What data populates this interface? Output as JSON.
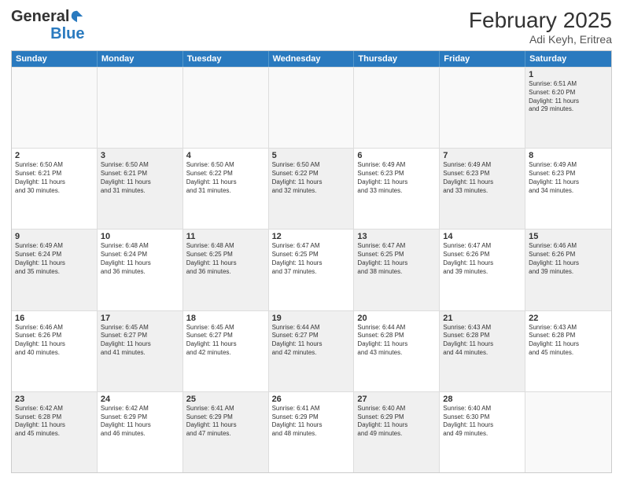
{
  "header": {
    "logo_general": "General",
    "logo_blue": "Blue",
    "title": "February 2025",
    "location": "Adi Keyh, Eritrea"
  },
  "days": [
    "Sunday",
    "Monday",
    "Tuesday",
    "Wednesday",
    "Thursday",
    "Friday",
    "Saturday"
  ],
  "rows": [
    [
      {
        "day": "",
        "text": "",
        "empty": true
      },
      {
        "day": "",
        "text": "",
        "empty": true
      },
      {
        "day": "",
        "text": "",
        "empty": true
      },
      {
        "day": "",
        "text": "",
        "empty": true
      },
      {
        "day": "",
        "text": "",
        "empty": true
      },
      {
        "day": "",
        "text": "",
        "empty": true
      },
      {
        "day": "1",
        "text": "Sunrise: 6:51 AM\nSunset: 6:20 PM\nDaylight: 11 hours\nand 29 minutes.",
        "empty": false,
        "shaded": true
      }
    ],
    [
      {
        "day": "2",
        "text": "Sunrise: 6:50 AM\nSunset: 6:21 PM\nDaylight: 11 hours\nand 30 minutes.",
        "shaded": false
      },
      {
        "day": "3",
        "text": "Sunrise: 6:50 AM\nSunset: 6:21 PM\nDaylight: 11 hours\nand 31 minutes.",
        "shaded": true
      },
      {
        "day": "4",
        "text": "Sunrise: 6:50 AM\nSunset: 6:22 PM\nDaylight: 11 hours\nand 31 minutes.",
        "shaded": false
      },
      {
        "day": "5",
        "text": "Sunrise: 6:50 AM\nSunset: 6:22 PM\nDaylight: 11 hours\nand 32 minutes.",
        "shaded": true
      },
      {
        "day": "6",
        "text": "Sunrise: 6:49 AM\nSunset: 6:23 PM\nDaylight: 11 hours\nand 33 minutes.",
        "shaded": false
      },
      {
        "day": "7",
        "text": "Sunrise: 6:49 AM\nSunset: 6:23 PM\nDaylight: 11 hours\nand 33 minutes.",
        "shaded": true
      },
      {
        "day": "8",
        "text": "Sunrise: 6:49 AM\nSunset: 6:23 PM\nDaylight: 11 hours\nand 34 minutes.",
        "shaded": false
      }
    ],
    [
      {
        "day": "9",
        "text": "Sunrise: 6:49 AM\nSunset: 6:24 PM\nDaylight: 11 hours\nand 35 minutes.",
        "shaded": true
      },
      {
        "day": "10",
        "text": "Sunrise: 6:48 AM\nSunset: 6:24 PM\nDaylight: 11 hours\nand 36 minutes.",
        "shaded": false
      },
      {
        "day": "11",
        "text": "Sunrise: 6:48 AM\nSunset: 6:25 PM\nDaylight: 11 hours\nand 36 minutes.",
        "shaded": true
      },
      {
        "day": "12",
        "text": "Sunrise: 6:47 AM\nSunset: 6:25 PM\nDaylight: 11 hours\nand 37 minutes.",
        "shaded": false
      },
      {
        "day": "13",
        "text": "Sunrise: 6:47 AM\nSunset: 6:25 PM\nDaylight: 11 hours\nand 38 minutes.",
        "shaded": true
      },
      {
        "day": "14",
        "text": "Sunrise: 6:47 AM\nSunset: 6:26 PM\nDaylight: 11 hours\nand 39 minutes.",
        "shaded": false
      },
      {
        "day": "15",
        "text": "Sunrise: 6:46 AM\nSunset: 6:26 PM\nDaylight: 11 hours\nand 39 minutes.",
        "shaded": true
      }
    ],
    [
      {
        "day": "16",
        "text": "Sunrise: 6:46 AM\nSunset: 6:26 PM\nDaylight: 11 hours\nand 40 minutes.",
        "shaded": false
      },
      {
        "day": "17",
        "text": "Sunrise: 6:45 AM\nSunset: 6:27 PM\nDaylight: 11 hours\nand 41 minutes.",
        "shaded": true
      },
      {
        "day": "18",
        "text": "Sunrise: 6:45 AM\nSunset: 6:27 PM\nDaylight: 11 hours\nand 42 minutes.",
        "shaded": false
      },
      {
        "day": "19",
        "text": "Sunrise: 6:44 AM\nSunset: 6:27 PM\nDaylight: 11 hours\nand 42 minutes.",
        "shaded": true
      },
      {
        "day": "20",
        "text": "Sunrise: 6:44 AM\nSunset: 6:28 PM\nDaylight: 11 hours\nand 43 minutes.",
        "shaded": false
      },
      {
        "day": "21",
        "text": "Sunrise: 6:43 AM\nSunset: 6:28 PM\nDaylight: 11 hours\nand 44 minutes.",
        "shaded": true
      },
      {
        "day": "22",
        "text": "Sunrise: 6:43 AM\nSunset: 6:28 PM\nDaylight: 11 hours\nand 45 minutes.",
        "shaded": false
      }
    ],
    [
      {
        "day": "23",
        "text": "Sunrise: 6:42 AM\nSunset: 6:28 PM\nDaylight: 11 hours\nand 45 minutes.",
        "shaded": true
      },
      {
        "day": "24",
        "text": "Sunrise: 6:42 AM\nSunset: 6:29 PM\nDaylight: 11 hours\nand 46 minutes.",
        "shaded": false
      },
      {
        "day": "25",
        "text": "Sunrise: 6:41 AM\nSunset: 6:29 PM\nDaylight: 11 hours\nand 47 minutes.",
        "shaded": true
      },
      {
        "day": "26",
        "text": "Sunrise: 6:41 AM\nSunset: 6:29 PM\nDaylight: 11 hours\nand 48 minutes.",
        "shaded": false
      },
      {
        "day": "27",
        "text": "Sunrise: 6:40 AM\nSunset: 6:29 PM\nDaylight: 11 hours\nand 49 minutes.",
        "shaded": true
      },
      {
        "day": "28",
        "text": "Sunrise: 6:40 AM\nSunset: 6:30 PM\nDaylight: 11 hours\nand 49 minutes.",
        "shaded": false
      },
      {
        "day": "",
        "text": "",
        "empty": true
      }
    ]
  ]
}
